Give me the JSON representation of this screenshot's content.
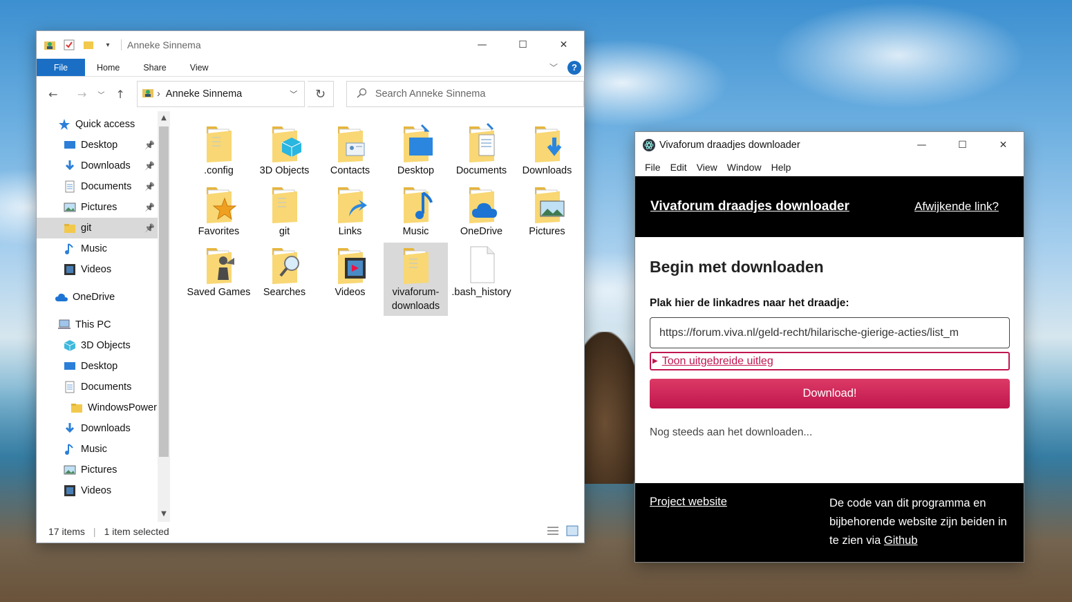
{
  "explorer": {
    "title": "Anneke Sinnema",
    "ribbon_tabs": [
      "File",
      "Home",
      "Share",
      "View"
    ],
    "address": "Anneke Sinnema",
    "search_placeholder": "Search Anneke Sinnema",
    "nav_items": [
      {
        "label": "Quick access",
        "icon": "star-icon",
        "pinned": false
      },
      {
        "label": "Desktop",
        "icon": "desktop-icon",
        "pinned": true
      },
      {
        "label": "Downloads",
        "icon": "download-icon",
        "pinned": true
      },
      {
        "label": "Documents",
        "icon": "document-icon",
        "pinned": true
      },
      {
        "label": "Pictures",
        "icon": "pictures-icon",
        "pinned": true
      },
      {
        "label": "git",
        "icon": "folder-icon",
        "pinned": true,
        "selected": true
      },
      {
        "label": "Music",
        "icon": "music-icon",
        "pinned": false
      },
      {
        "label": "Videos",
        "icon": "videos-icon",
        "pinned": false
      },
      {
        "label": "OneDrive",
        "icon": "cloud-icon",
        "pinned": false
      },
      {
        "label": "This PC",
        "icon": "pc-icon",
        "pinned": false
      },
      {
        "label": "3D Objects",
        "icon": "cube-icon",
        "pinned": false
      },
      {
        "label": "Desktop",
        "icon": "desktop-icon",
        "pinned": false
      },
      {
        "label": "Documents",
        "icon": "document-icon",
        "pinned": false
      },
      {
        "label": "WindowsPower",
        "icon": "folder-icon",
        "pinned": false
      },
      {
        "label": "Downloads",
        "icon": "download-icon",
        "pinned": false
      },
      {
        "label": "Music",
        "icon": "music-icon",
        "pinned": false
      },
      {
        "label": "Pictures",
        "icon": "pictures-icon",
        "pinned": false
      },
      {
        "label": "Videos",
        "icon": "videos-icon",
        "pinned": false
      }
    ],
    "files": [
      {
        "name": ".config",
        "icon": "folder-doc-icon"
      },
      {
        "name": "3D Objects",
        "icon": "folder-cube-icon"
      },
      {
        "name": "Contacts",
        "icon": "folder-contact-icon"
      },
      {
        "name": "Desktop",
        "icon": "folder-desktop-icon"
      },
      {
        "name": "Documents",
        "icon": "folder-documents-icon"
      },
      {
        "name": "Downloads",
        "icon": "folder-download-icon"
      },
      {
        "name": "Favorites",
        "icon": "folder-star-icon"
      },
      {
        "name": "git",
        "icon": "folder-doc-icon"
      },
      {
        "name": "Links",
        "icon": "folder-link-icon"
      },
      {
        "name": "Music",
        "icon": "folder-music-icon"
      },
      {
        "name": "OneDrive",
        "icon": "folder-cloud-icon"
      },
      {
        "name": "Pictures",
        "icon": "folder-picture-icon"
      },
      {
        "name": "Saved Games",
        "icon": "folder-games-icon"
      },
      {
        "name": "Searches",
        "icon": "folder-search-icon"
      },
      {
        "name": "Videos",
        "icon": "folder-video-icon"
      },
      {
        "name": "vivaforum-downloads",
        "icon": "folder-doc-icon",
        "selected": true
      },
      {
        "name": ".bash_history",
        "icon": "file-icon"
      }
    ],
    "status_items": "17 items",
    "status_selected": "1 item selected",
    "accent": "#1a6fc4"
  },
  "viva": {
    "window_title": "Vivaforum draadjes downloader",
    "menu": [
      "File",
      "Edit",
      "View",
      "Window",
      "Help"
    ],
    "brand": "Vivaforum draadjes downloader",
    "alt_link": "Afwijkende link?",
    "heading": "Begin met downloaden",
    "input_label": "Plak hier de linkadres naar het draadje:",
    "input_value": "https://forum.viva.nl/geld-recht/hilarische-gierige-acties/list_m",
    "details_label": "Toon uitgebreide uitleg",
    "download_label": "Download!",
    "status": "Nog steeds aan het downloaden...",
    "footer_project": "Project website",
    "footer_code": "De code van dit programma en bijbehorende website zijn beiden in te zien via",
    "footer_github": "Github",
    "accent": "#c0164e"
  }
}
